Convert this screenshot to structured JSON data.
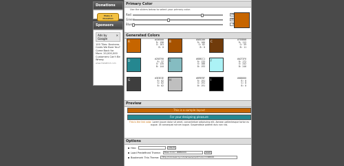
{
  "sidebar": {
    "donations_title": "Donations",
    "donate_label": "Make A Donation",
    "sponsors_title": "Sponsors",
    "ad_title": "Ads by Google",
    "ad_text": "100 Tiles: Business Cards We Bore You? Come Back for More. 20,000,000 Customers Can't Be Wrong",
    "ad_link": "www.VistaPrint.com"
  },
  "primary": {
    "title": "Primary Color",
    "hint": "Use the sliders below to select your primary color.",
    "red_label": "Red:",
    "green_label": "Green:",
    "blue_label": "Blue:",
    "red": 198,
    "green": 101,
    "blue": 0,
    "swatch_color": "#c66500"
  },
  "generated": {
    "title": "Generated Colors",
    "colors": [
      {
        "label": "A",
        "hex": "#C66500",
        "hex_label": "#C66500",
        "r": "R: 198",
        "g": "G: 101",
        "b": "B: 0"
      },
      {
        "label": "B",
        "hex": "#A65200",
        "hex_label": "#A65200",
        "r": "R: 166",
        "g": "G: 82",
        "b": "B: 0"
      },
      {
        "label": "C",
        "hex": "#703B0B",
        "hex_label": "#703B0B",
        "r": "R: 112",
        "g": "G: 59",
        "b": "B: 11"
      },
      {
        "label": "D",
        "hex": "#258790",
        "hex_label": "#258790",
        "r": "R: 37",
        "g": "G: 135",
        "b": "B: 144"
      },
      {
        "label": "E",
        "hex": "#85BCC1",
        "hex_label": "#85BCC1",
        "r": "R: 133",
        "g": "G: 188",
        "b": "B: 193"
      },
      {
        "label": "F",
        "hex": "#ACF2F6",
        "hex_label": "#ACF2F6",
        "r": "R: 172",
        "g": "G: 242",
        "b": "B: 246"
      },
      {
        "label": "G",
        "hex": "#3E3E3E",
        "hex_label": "#3E3E3E",
        "r": "R: 62",
        "g": "G: 62",
        "b": "B: 62"
      },
      {
        "label": "H",
        "hex": "#BFBFBF",
        "hex_label": "#BFBFBF",
        "r": "R: 191",
        "g": "G: 191",
        "b": "B: 191"
      },
      {
        "label": "I",
        "hex": "#000000",
        "hex_label": "#000000",
        "r": "R: 0",
        "g": "G: 0",
        "b": "B: 0"
      }
    ]
  },
  "preview": {
    "title": "Preview",
    "bar1": "This is a sample layout",
    "bar2": "For your designing pleasure",
    "link_text": "This is the link color.",
    "body_text": "Lorem ipsum dolor sit amet, consectetuer adipiscing elit. Aenean pellentesque tortor eu augue. Ut consequat rutrum augue. Suspendisse potenti duis non nisi."
  },
  "options": {
    "title": "Options",
    "hex_label": "Hex:",
    "hex_button": "Use It",
    "load_label": "Load Predefined Theme:",
    "load_value": "Base Color: #BB0000",
    "load_button": "Load",
    "bookmark_label": "Bookmark This Theme:",
    "bookmark_value": "http://colorsexcry.com/anwers/cpd/?color=C66500"
  }
}
